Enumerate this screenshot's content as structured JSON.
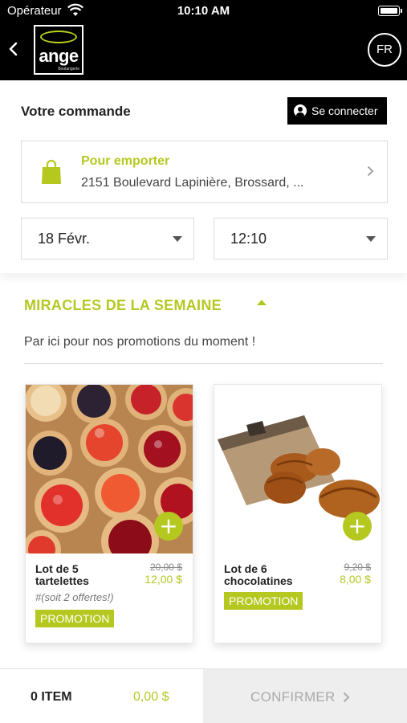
{
  "status_bar": {
    "carrier": "Opérateur",
    "time": "10:10 AM"
  },
  "header": {
    "logo_text": "ange",
    "logo_sub": "Boulangerie",
    "language": "FR"
  },
  "order": {
    "title": "Votre commande",
    "login_label": "Se connecter",
    "pickup_title": "Pour emporter",
    "pickup_address": "2151 Boulevard Lapinière, Brossard, ...",
    "date": "18 Févr.",
    "time": "12:10"
  },
  "category": {
    "title": "MIRACLES DE LA SEMAINE",
    "description": "Par ici pour nos promotions du moment !"
  },
  "products": [
    {
      "name": "Lot de 5 tartelettes",
      "old_price": "20,00 $",
      "price": "12,00 $",
      "note": "#(soit 2 offertes!)",
      "badge": "PROMOTION",
      "add_label": "+"
    },
    {
      "name": "Lot de 6 chocolatines",
      "old_price": "9,20 $",
      "price": "8,00 $",
      "badge": "PROMOTION",
      "add_label": "+"
    }
  ],
  "cart": {
    "items": "0 ITEM",
    "total": "0,00 $",
    "confirm_label": "CONFIRMER"
  },
  "colors": {
    "accent": "#b5c820",
    "header_bg": "#000000"
  },
  "icons": [
    "wifi-icon",
    "battery-icon",
    "back-chevron-icon",
    "user-icon",
    "shopping-bag-icon",
    "chevron-right-icon",
    "dropdown-caret-icon",
    "collapse-caret-icon",
    "plus-icon"
  ]
}
